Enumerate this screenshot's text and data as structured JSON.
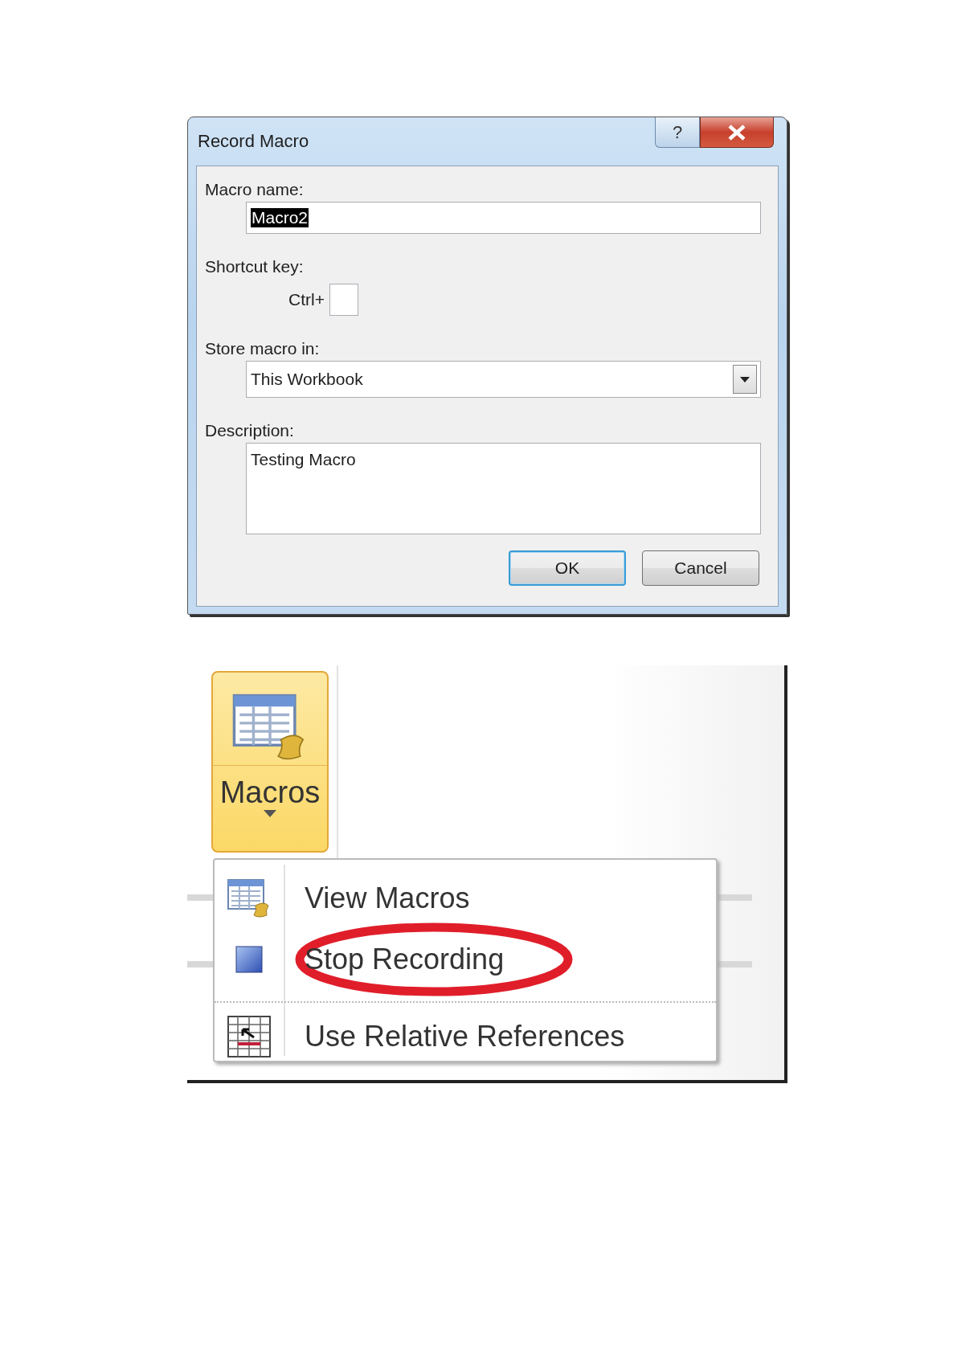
{
  "dialog": {
    "title": "Record Macro",
    "help_button": "?",
    "macro_name": {
      "label": "Macro name:",
      "value": "Macro2",
      "value_selected": true
    },
    "shortcut": {
      "label": "Shortcut key:",
      "prefix": "Ctrl+"
    },
    "store": {
      "label": "Store macro in:",
      "value": "This Workbook"
    },
    "description": {
      "label": "Description:",
      "value": "Testing Macro"
    },
    "buttons": [
      {
        "label": "OK",
        "default": true
      },
      {
        "label": "Cancel",
        "default": false
      }
    ]
  },
  "ribbon": {
    "macros_button": {
      "label": "Macros",
      "highlighted": true
    },
    "menu": [
      {
        "label": "View Macros",
        "kind": "view",
        "circled": false
      },
      {
        "label": "Stop Recording",
        "kind": "stop",
        "circled": true
      },
      {
        "label": "Use Relative References",
        "kind": "relative",
        "circled": false
      }
    ]
  }
}
